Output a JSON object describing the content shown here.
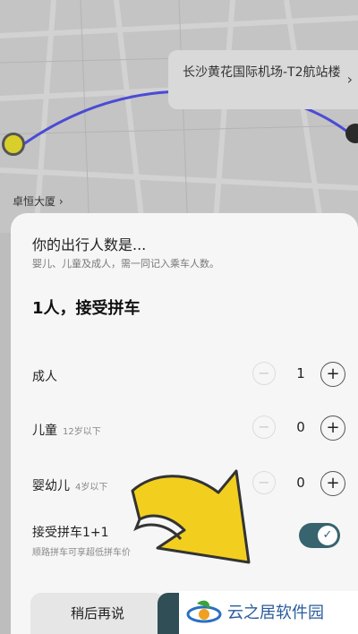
{
  "map": {
    "destination": "长沙黄花国际机场-T2航站楼",
    "origin": "卓恒大厦"
  },
  "sheet": {
    "title": "你的出行人数是...",
    "subtitle": "婴儿、儿童及成人，需一同记入乘车人数。",
    "summary": "1人，接受拼车",
    "rows": [
      {
        "label": "成人",
        "note": "",
        "value": "1"
      },
      {
        "label": "儿童",
        "note": "12岁以下",
        "value": "0"
      },
      {
        "label": "婴幼儿",
        "note": "4岁以下",
        "value": "0"
      }
    ],
    "carpool": {
      "title": "接受拼车1+1",
      "desc": "顺路拼车可享超低拼车价",
      "enabled": true
    },
    "buttons": {
      "later": "稍后再说"
    }
  },
  "watermark": {
    "text": "云之居软件园"
  },
  "colors": {
    "accent": "#37646e",
    "route": "#4b4bd6",
    "arrow": "#f2cf1f"
  }
}
